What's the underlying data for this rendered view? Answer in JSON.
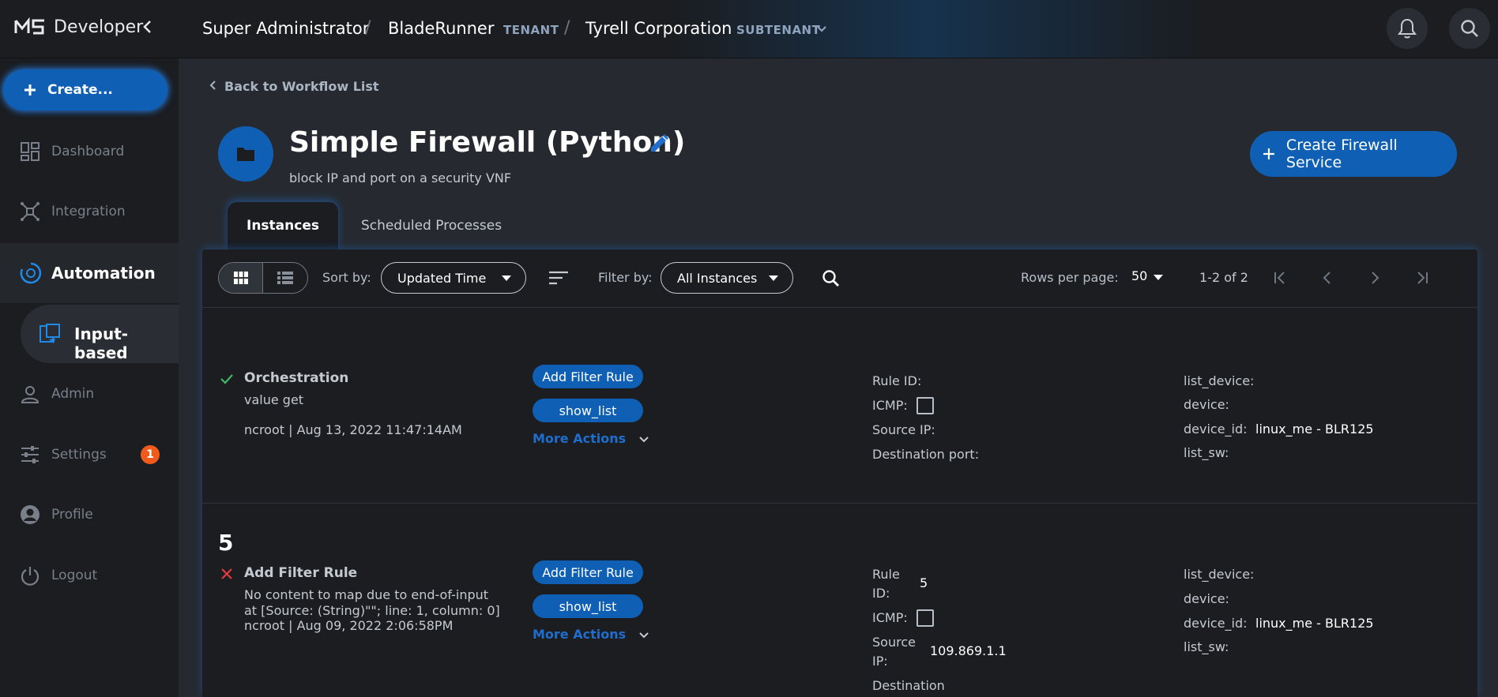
{
  "app": {
    "name": "Developer"
  },
  "breadcrumb": {
    "root": "Super Administrator",
    "tenant": "BladeRunner",
    "tenant_tag": "TENANT",
    "subtenant": "Tyrell Corporation",
    "subtenant_tag": "SUBTENANT"
  },
  "sidebar": {
    "create_label": "Create...",
    "items": [
      {
        "label": "Dashboard",
        "icon": "dashboard-icon"
      },
      {
        "label": "Integration",
        "icon": "integration-icon"
      },
      {
        "label": "Automation",
        "icon": "automation-icon"
      },
      {
        "label": "Admin",
        "icon": "admin-icon"
      },
      {
        "label": "Settings",
        "icon": "settings-icon",
        "badge": "1"
      },
      {
        "label": "Profile",
        "icon": "profile-icon"
      },
      {
        "label": "Logout",
        "icon": "logout-icon"
      }
    ],
    "sub_item": {
      "label": "Input-based"
    }
  },
  "workflow": {
    "back_label": "Back to Workflow List",
    "title": "Simple Firewall (Python)",
    "description": "block IP and port on a security VNF",
    "primary_action": "Create Firewall Service"
  },
  "tabs": [
    {
      "label": "Instances",
      "active": true
    },
    {
      "label": "Scheduled Processes",
      "active": false
    }
  ],
  "toolbar": {
    "sort_label": "Sort by:",
    "sort_value": "Updated Time",
    "filter_label": "Filter by:",
    "filter_value": "All Instances",
    "rows_label": "Rows per page:",
    "rows_value": "50",
    "page_info": "1-2 of 2"
  },
  "instances": [
    {
      "id": "",
      "status": "success",
      "process": "Orchestration",
      "message": "value get",
      "meta": "ncroot | Aug 13, 2022 11:47:14AM",
      "actions": [
        "Add Filter Rule",
        "show_list"
      ],
      "more_actions": "More Actions",
      "params": {
        "rule_id_label": "Rule ID:",
        "rule_id": "",
        "icmp_label": "ICMP:",
        "source_ip_label": "Source IP:",
        "source_ip": "",
        "dest_port_label": "Destination port:"
      },
      "device": {
        "list_device_label": "list_device:",
        "device_label": "device:",
        "device_id_label": "device_id:",
        "device_id": "linux_me - BLR125",
        "list_sw_label": "list_sw:"
      }
    },
    {
      "id": "5",
      "status": "error",
      "process": "Add Filter Rule",
      "message": "No content to map due to end-of-input at [Source: (String)\"\"; line: 1, column: 0]",
      "meta": "ncroot | Aug 09, 2022 2:06:58PM",
      "actions": [
        "Add Filter Rule",
        "show_list"
      ],
      "more_actions": "More Actions",
      "params": {
        "rule_label_1": "Rule",
        "rule_label_2": "ID:",
        "rule_id": "5",
        "icmp_label": "ICMP:",
        "source_label_1": "Source",
        "source_label_2": "IP:",
        "source_ip": "109.869.1.1",
        "dest_label": "Destination"
      },
      "device": {
        "list_device_label": "list_device:",
        "device_label": "device:",
        "device_id_label": "device_id:",
        "device_id": "linux_me - BLR125",
        "list_sw_label": "list_sw:"
      }
    }
  ],
  "colors": {
    "accent": "#0f5fb4",
    "success": "#3fb866",
    "error": "#e23a3a",
    "badge": "#f05a1a"
  }
}
